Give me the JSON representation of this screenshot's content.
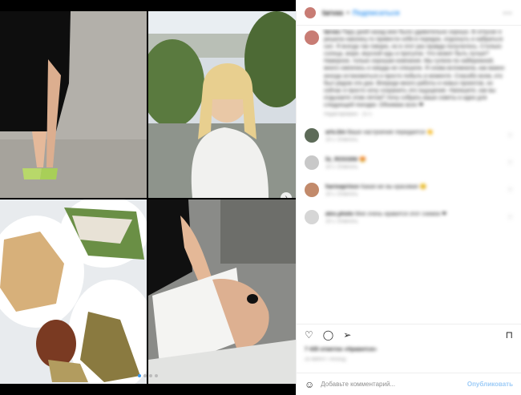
{
  "post": {
    "images": [
      "black-dress-green-heels",
      "blonde-woman-white-top",
      "grilled-flatbread-and-vegetables",
      "hand-holding-menu"
    ],
    "carousel_active": 1,
    "carousel_count": 4,
    "next_icon": "chevron-right-icon"
  },
  "header": {
    "username": "tarvas",
    "separator": "•",
    "follow_label": "Подписаться",
    "more_icon": "more-horizontal-icon"
  },
  "caption": {
    "username": "tarvas",
    "text": "Пару дней назад мне было удивительно хорошо. В отпуске я решила наконец-то привести себя в порядок, отдохнуть и набраться сил. Я всегда так говорю, но в этот раз правда получилось. Столько солнца, моря, вкусной еды и прогулок. Что может быть лучше? Наверное, только хорошая компания. Мы гуляли по набережной, много смеялись и никуда не спешили. Я снова вспомнила, как важно иногда остановиться и просто побыть в моменте. Спасибо всем, кто был рядом эти дни. Впереди много работы и новых проектов, но сейчас я просто хочу сохранить это ощущение. Напишите, как вы отдыхаете этим летом? Хочу собрать ваши советы и идеи для следующей поездки. Обнимаю всех ❤",
    "time": "Редактировано · 15 ч."
  },
  "comments": [
    {
      "username": "arts.bio",
      "text": "Ваше настроение передается 👏",
      "meta": "15 ч.   Ответить"
    },
    {
      "username": "liz_ROSSINI",
      "text": "😍",
      "meta": "15 ч.   Ответить"
    },
    {
      "username": "harmaprince",
      "text": "Какая же вы красивая 😊",
      "meta": "15 ч.   Ответить"
    },
    {
      "username": "alex.photo",
      "text": "Мне очень нравится этот снимок ❤",
      "meta": "15 ч.   Ответить"
    }
  ],
  "comment_colors": [
    "#5d6b58",
    "#c8c8c8",
    "#c28a6b",
    "#d6d6d6"
  ],
  "actions": {
    "like_icon": "heart-icon",
    "comment_icon": "comment-icon",
    "share_icon": "paper-plane-icon",
    "save_icon": "bookmark-icon"
  },
  "likes_text": "7 435 отметок «Нравится»",
  "date_text": "25 МИНУТ НАЗАД",
  "add_comment": {
    "placeholder": "Добавьте комментарий...",
    "post_label": "Опубликовать",
    "emoji_icon": "smile-icon"
  }
}
